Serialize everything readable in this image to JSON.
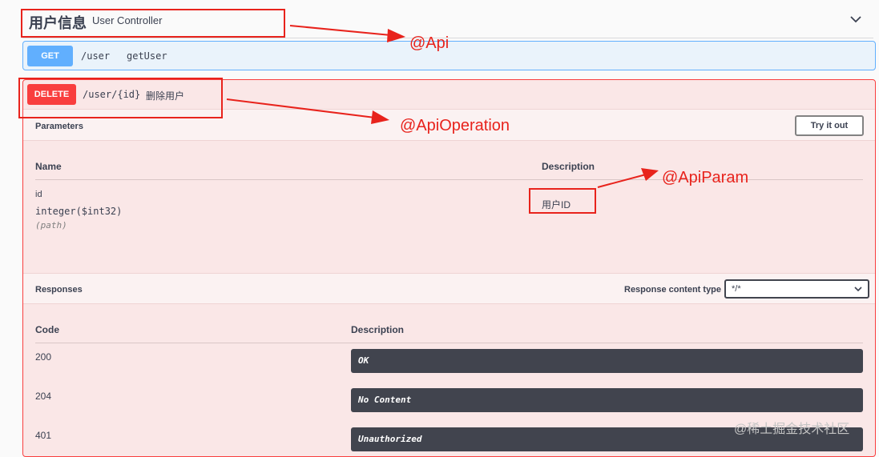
{
  "tag": {
    "name": "用户信息",
    "description": "User Controller"
  },
  "operations": {
    "get": {
      "method": "GET",
      "path": "/user",
      "summary": "getUser"
    },
    "delete": {
      "method": "DELETE",
      "path": "/user/{id}",
      "summary": "删除用户"
    }
  },
  "parameters": {
    "title": "Parameters",
    "try_button": "Try it out",
    "col_name": "Name",
    "col_description": "Description",
    "items": [
      {
        "name": "id",
        "type": "integer($int32)",
        "in": "(path)",
        "description": "用户ID"
      }
    ]
  },
  "responses": {
    "title": "Responses",
    "content_type_label": "Response content type",
    "content_type_value": "*/*",
    "col_code": "Code",
    "col_description": "Description",
    "items": [
      {
        "code": "200",
        "description": "OK"
      },
      {
        "code": "204",
        "description": "No Content"
      },
      {
        "code": "401",
        "description": "Unauthorized"
      }
    ]
  },
  "annotations": {
    "api": "@Api",
    "api_operation": "@ApiOperation",
    "api_param": "@ApiParam",
    "color": "#e8231c"
  },
  "watermark": "@稀土掘金技术社区",
  "icons": {
    "tag_toggle": "chevron-down-icon",
    "select_toggle": "chevron-down-icon"
  },
  "colors": {
    "get": "#61affe",
    "delete": "#f93e3e"
  }
}
